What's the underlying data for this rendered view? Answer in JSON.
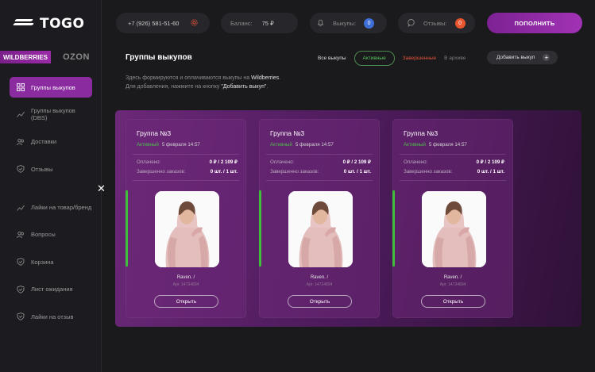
{
  "brand": {
    "logo_text": "TOGO"
  },
  "marketplaces": [
    {
      "label": "WILDBERRIES",
      "active": true
    },
    {
      "label": "OZON",
      "active": false
    }
  ],
  "sidebar": {
    "items": [
      {
        "label": "Группы выкупов",
        "icon": "grid-icon",
        "active": true
      },
      {
        "label": "Группы выкупов (DBS)",
        "icon": "chart-icon",
        "active": false
      },
      {
        "label": "Доставки",
        "icon": "users-icon",
        "active": false
      },
      {
        "label": "Отзывы",
        "icon": "shield-icon",
        "active": false
      },
      {
        "label": "Лайки на товар/бренд",
        "icon": "chart-icon",
        "active": false
      },
      {
        "label": "Вопросы",
        "icon": "users-icon",
        "active": false
      },
      {
        "label": "Корзина",
        "icon": "shield-icon",
        "active": false
      },
      {
        "label": "Лист ожидания",
        "icon": "shield-icon",
        "active": false
      },
      {
        "label": "Лайки на отзыв",
        "icon": "shield-icon",
        "active": false
      }
    ]
  },
  "topbar": {
    "phone": "+7 (926) 581-51-60",
    "balance_label": "Баланс:",
    "balance_value": "75 ₽",
    "buyouts_label": "Выкупы:",
    "buyouts_count": "0",
    "reviews_label": "Отзывы:",
    "reviews_count": "0",
    "topup_label": "ПОПОЛНИТЬ"
  },
  "header": {
    "title": "Группы выкупов",
    "filters": [
      "Все выкупы",
      "Активные",
      "Завершенные",
      "В архиве"
    ],
    "add_label": "Добавить выкуп",
    "desc_line1_pre": "Здесь формируются и оплачиваются выкупы на ",
    "desc_line1_brand": "Wildberries",
    "desc_line1_post": ".",
    "desc_line2_pre": "Для добавления, нажмите на кнопку ",
    "desc_line2_btn": "\"Добавить выкуп\"",
    "desc_line2_post": "."
  },
  "cards": [
    {
      "title": "Группа №3",
      "status": "Активный",
      "date": "5 февраля 14:57",
      "paid_label": "Оплачено:",
      "paid_value": "0 ₽ / 2 109 ₽",
      "ordered_label": "Завершенно заказов:",
      "ordered_value": "0 шт. / 1 шт.",
      "product_name": "Raven. /",
      "article": "Арт. 14724894",
      "open_label": "Открыть"
    },
    {
      "title": "Группа №3",
      "status": "Активный",
      "date": "5 февраля 14:57",
      "paid_label": "Оплачено:",
      "paid_value": "0 ₽ / 2 109 ₽",
      "ordered_label": "Завершенно заказов:",
      "ordered_value": "0 шт. / 1 шт.",
      "product_name": "Raven. /",
      "article": "Арт. 14724894",
      "open_label": "Открыть"
    },
    {
      "title": "Группа №3",
      "status": "Активный",
      "date": "5 февраля 14:57",
      "paid_label": "Оплачено:",
      "paid_value": "0 ₽ / 2 109 ₽",
      "ordered_label": "Завершенно заказов:",
      "ordered_value": "0 шт. / 1 шт.",
      "product_name": "Raven. /",
      "article": "Арт. 14724894",
      "open_label": "Открыть"
    }
  ],
  "colors": {
    "accent": "#9b2aa8",
    "active_green": "#56c35a",
    "done_red": "#e2533c",
    "buyouts_badge": "#3e6fd8",
    "reviews_badge": "#e8552f"
  }
}
